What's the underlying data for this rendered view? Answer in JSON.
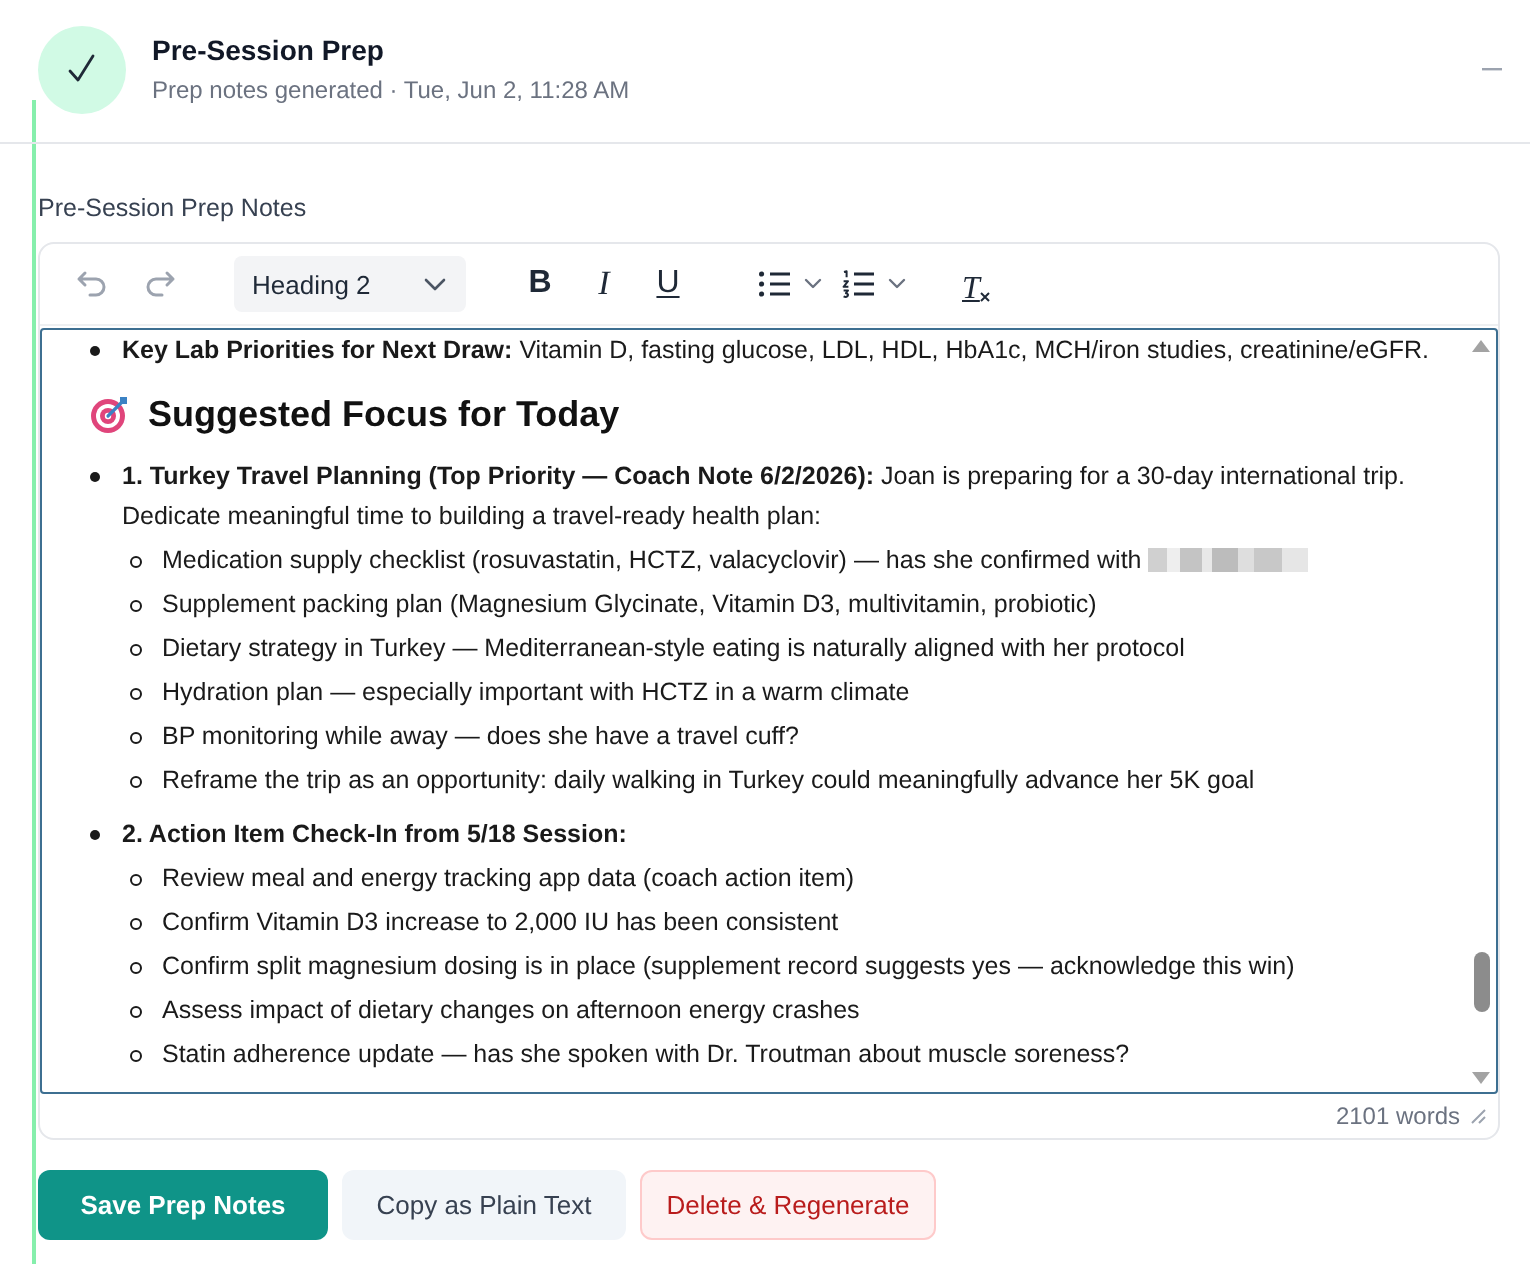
{
  "header": {
    "title": "Pre-Session Prep",
    "subtitle": "Prep notes generated · Tue, Jun 2, 11:28 AM"
  },
  "editor": {
    "label": "Pre-Session Prep Notes",
    "toolbar": {
      "block_format": "Heading 2",
      "format_buttons": [
        {
          "kind": "bold",
          "label": "B"
        },
        {
          "kind": "italic",
          "label": "I"
        },
        {
          "kind": "underline",
          "label": "U"
        }
      ],
      "clear_label": "T"
    },
    "content": [
      {
        "kind": "bullet",
        "lead": "Key Lab Priorities for Next Draw:",
        "text": "Vitamin D, fasting glucose, LDL, HDL, HbA1c, MCH/iron studies, creatinine/eGFR."
      },
      {
        "kind": "heading",
        "text": "Suggested Focus for Today"
      },
      {
        "kind": "bullet",
        "lead": "1. Turkey Travel Planning (Top Priority — Coach Note 6/2/2026):",
        "text": "Joan is preparing for a 30-day international trip. Dedicate meaningful time to building a travel-ready health plan:",
        "children": [
          {
            "text": "Medication supply checklist (rosuvastatin, HCTZ, valacyclovir) — has she confirmed with",
            "redacted": true
          },
          {
            "text": "Supplement packing plan (Magnesium Glycinate, Vitamin D3, multivitamin, probiotic)",
            "redacted": false
          },
          {
            "text": "Dietary strategy in Turkey — Mediterranean-style eating is naturally aligned with her protocol",
            "redacted": false
          },
          {
            "text": "Hydration plan — especially important with HCTZ in a warm climate",
            "redacted": false
          },
          {
            "text": "BP monitoring while away — does she have a travel cuff?",
            "redacted": false
          },
          {
            "text": "Reframe the trip as an opportunity: daily walking in Turkey could meaningfully advance her 5K goal",
            "redacted": false
          }
        ]
      },
      {
        "kind": "bullet",
        "lead": "2. Action Item Check-In from 5/18 Session:",
        "children": [
          {
            "text": "Review meal and energy tracking app data (coach action item)",
            "redacted": false
          },
          {
            "text": "Confirm Vitamin D3 increase to 2,000 IU has been consistent",
            "redacted": false
          },
          {
            "text": "Confirm split magnesium dosing is in place (supplement record suggests yes — acknowledge this win)",
            "redacted": false
          },
          {
            "text": "Assess impact of dietary changes on afternoon energy crashes",
            "redacted": false
          },
          {
            "text": "Statin adherence update — has she spoken with Dr. Troutman about muscle soreness?",
            "redacted": false
          }
        ]
      }
    ],
    "word_count": "2101 words"
  },
  "actions": [
    {
      "kind": "primary",
      "label": "Save Prep Notes"
    },
    {
      "kind": "secondary",
      "label": "Copy as Plain Text"
    },
    {
      "kind": "danger",
      "label": "Delete & Regenerate"
    }
  ]
}
